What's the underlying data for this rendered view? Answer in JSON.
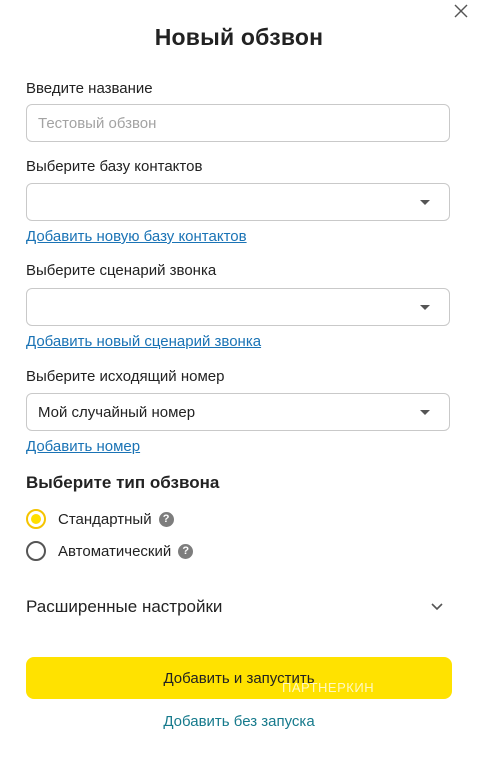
{
  "dialog": {
    "title": "Новый обзвон",
    "close_icon": "close-icon"
  },
  "name_field": {
    "label": "Введите название",
    "value": "",
    "placeholder": "Тестовый обзвон"
  },
  "contacts": {
    "label": "Выберите базу контактов",
    "selected": "",
    "add_link": "Добавить новую базу контактов"
  },
  "scenario": {
    "label": "Выберите сценарий звонка",
    "selected": "",
    "add_link": "Добавить новый сценарий звонка"
  },
  "outgoing": {
    "label": "Выберите исходящий номер",
    "selected": "Мой случайный номер",
    "add_link": "Добавить номер"
  },
  "call_type": {
    "title": "Выберите тип обзвона",
    "options": [
      {
        "label": "Стандартный",
        "checked": true,
        "help_icon": "question-icon"
      },
      {
        "label": "Автоматический",
        "checked": false,
        "help_icon": "question-icon"
      }
    ]
  },
  "advanced": {
    "label": "Расширенные настройки",
    "icon": "chevron-down-icon"
  },
  "actions": {
    "primary": "Добавить и запустить",
    "secondary": "Добавить без запуска"
  },
  "watermark": "ПАРТНЕРКИН",
  "colors": {
    "accent": "#ffe200",
    "link": "#1a73b5",
    "secondary_link": "#167a8c"
  }
}
